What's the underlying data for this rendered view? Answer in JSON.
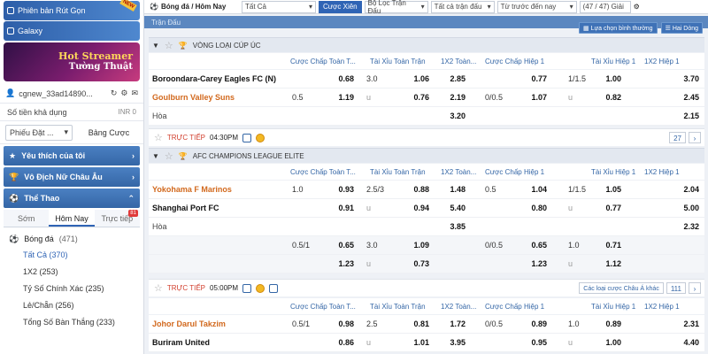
{
  "sidebar": {
    "banner1": "Phiên bản Rút Gọn",
    "banner1_tag": "NEW",
    "banner2": "Galaxy",
    "promo_line1": "Hot Streamer",
    "promo_line2": "Tường Thuật",
    "username": "cgnew_33ad14890...",
    "balance_label": "Số tiền khả dụng",
    "balance_value": "INR 0",
    "slip_select": "Phiếu Đặt ...",
    "slip_tab": "Bảng Cược",
    "sec_fav": "Yêu thích của tôi",
    "sec_euro": "Vô Địch Nữ Châu Âu",
    "sec_sport": "Thể Thao",
    "tabs": [
      "Sớm",
      "Hôm Nay",
      "Trực tiếp"
    ],
    "live_badge": "81",
    "sport_name": "Bóng đá",
    "sport_count": "(471)",
    "subs": [
      "Tất Cả (370)",
      "1X2 (253)",
      "Tỷ Số Chính Xác (235)",
      "Lẻ/Chẵn (256)",
      "Tổng Số Bàn Thắng (233)"
    ]
  },
  "topbar": {
    "title": "Bóng đá / Hôm Nay",
    "all": "Tất Cả",
    "parlay": "Cược Xiên",
    "league_filter": "Bộ Lọc Trận Đấu",
    "all_matches": "Tất cả trận đấu",
    "time_sort": "Từ trước đến nay",
    "count": "(47 / 47) Giải"
  },
  "strip_label": "Trận Đấu",
  "tools": {
    "sort": "Lựa chọn bình thường",
    "lines": "Hai Dòng"
  },
  "columns": [
    "Cược Chấp Toàn T...",
    "Tài Xỉu Toàn Trận",
    "1X2 Toàn...",
    "Cược Chấp Hiệp 1",
    "Tài Xỉu Hiệp 1",
    "1X2 Hiệp 1"
  ],
  "leagues": [
    {
      "name": "VÒNG LOẠI CÚP ÚC"
    },
    {
      "name": "AFC CHAMPIONS LEAGUE ELITE"
    }
  ],
  "match1": {
    "home": "Boroondara-Carey Eagles FC (N)",
    "away": "Goulburn Valley Suns",
    "draw": "Hòa",
    "r1": {
      "ah_o": "0.68",
      "ou_l": "3.0",
      "ou_o": "1.06",
      "x1": "2.85",
      "h_o": "0.77",
      "hou_l": "1/1.5",
      "hou_o": "1.00",
      "hx": "3.70"
    },
    "r2": {
      "ah_l": "0.5",
      "ah_o": "1.19",
      "ou_l": "u",
      "ou_o": "0.76",
      "x2": "2.19",
      "h_l": "0/0.5",
      "h_o": "1.07",
      "hou_l": "u",
      "hou_o": "0.82",
      "hx": "2.45"
    },
    "r3": {
      "x": "3.20",
      "hx": "2.15"
    },
    "time": "04:30PM",
    "live": "TRỰC TIẾP",
    "more": "27"
  },
  "match2": {
    "home": "Yokohama F Marinos",
    "away": "Shanghai Port FC",
    "draw": "Hòa",
    "r1": {
      "ah_l": "1.0",
      "ah_o": "0.93",
      "ou_l": "2.5/3",
      "ou_o": "0.88",
      "x1": "1.48",
      "h_l": "0.5",
      "h_o": "1.04",
      "hou_l": "1/1.5",
      "hou_o": "1.05",
      "hx": "2.04"
    },
    "r2": {
      "ah_o": "0.91",
      "ou_l": "u",
      "ou_o": "0.94",
      "x2": "5.40",
      "h_o": "0.80",
      "hou_l": "u",
      "hou_o": "0.77",
      "hx": "5.00"
    },
    "r3": {
      "x": "3.85",
      "hx": "2.32"
    },
    "r4": {
      "ah_l": "0.5/1",
      "ah_o": "0.65",
      "ou_l": "3.0",
      "ou_o": "1.09",
      "h_l": "0/0.5",
      "h_o": "0.65",
      "hou_l": "1.0",
      "hou_o": "0.71"
    },
    "r5": {
      "ah_o": "1.23",
      "ou_l": "u",
      "ou_o": "0.73",
      "h_o": "1.23",
      "hou_l": "u",
      "hou_o": "1.12"
    },
    "time": "05:00PM",
    "live": "TRỰC TIẾP",
    "more_select": "Các loại cược Châu Á khác",
    "more": "111"
  },
  "match3": {
    "home": "Johor Darul Takzim",
    "away": "Buriram United",
    "r1": {
      "ah_l": "0.5/1",
      "ah_o": "0.98",
      "ou_l": "2.5",
      "ou_o": "0.81",
      "x1": "1.72",
      "h_l": "0/0.5",
      "h_o": "0.89",
      "hou_l": "1.0",
      "hou_o": "0.89",
      "hx": "2.31"
    },
    "r2": {
      "ah_o": "0.86",
      "ou_l": "u",
      "ou_o": "1.01",
      "x2": "3.95",
      "h_o": "0.95",
      "hou_l": "u",
      "hou_o": "1.00",
      "hx": "4.40"
    }
  }
}
